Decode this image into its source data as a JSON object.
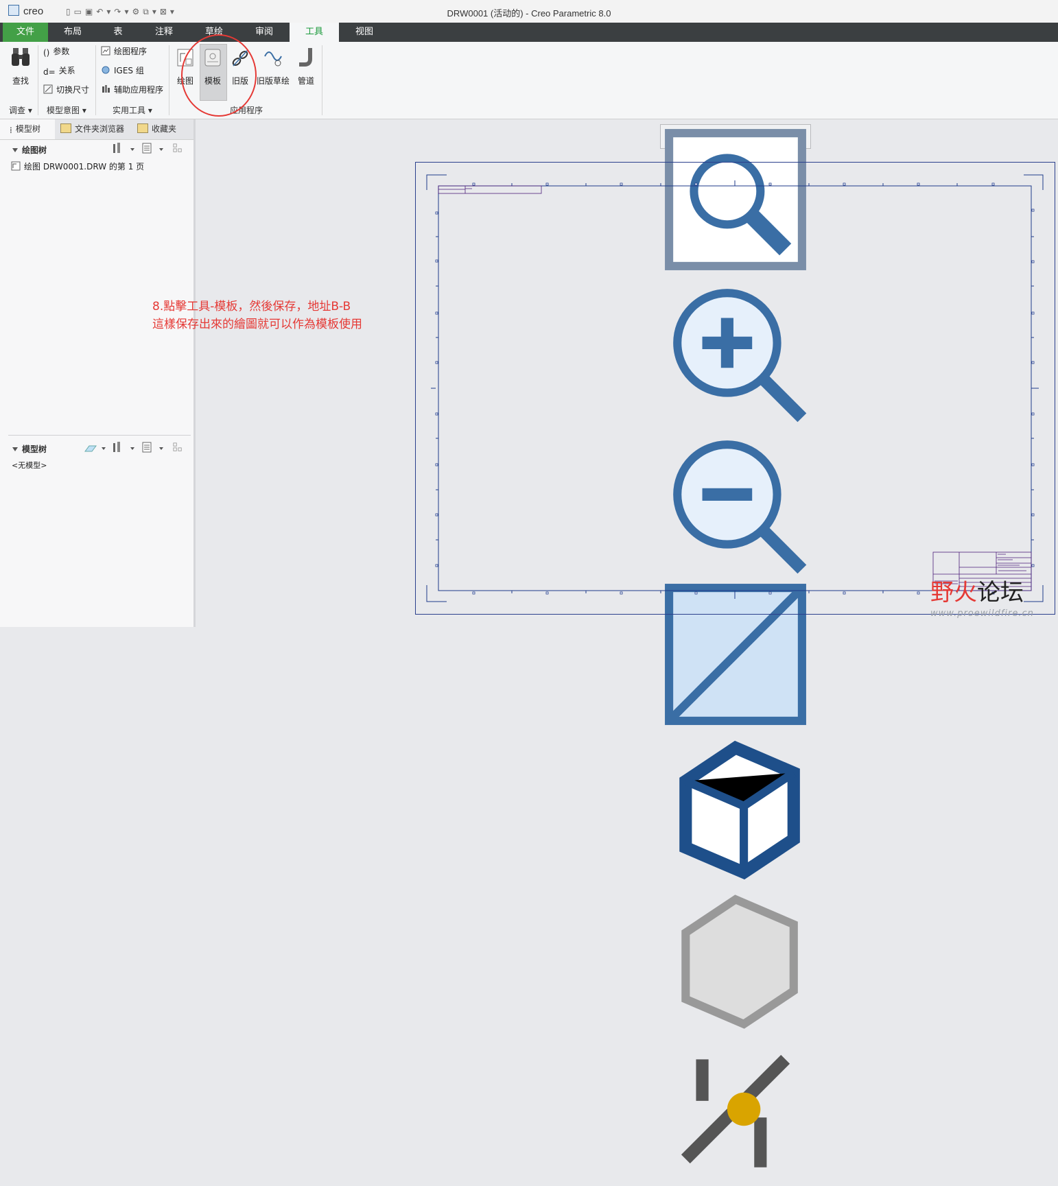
{
  "app": {
    "logo_text": "creo",
    "window_title": "DRW0001 (活动的) - Creo Parametric 8.0"
  },
  "tabs": [
    "文件",
    "布局",
    "表",
    "注释",
    "草绘",
    "审阅",
    "工具",
    "视图"
  ],
  "ribbon": {
    "investigate": {
      "find_label": "查找",
      "group_label": "调查"
    },
    "model_intent": {
      "params": "参数",
      "relations": "关系",
      "switch_dims": "切换尺寸",
      "group_label": "模型意图"
    },
    "utilities": {
      "drawing_program": "绘图程序",
      "iges_group": "IGES 组",
      "aux_apps": "辅助应用程序",
      "group_label": "实用工具"
    },
    "applications": {
      "drawing": "绘图",
      "template": "模板",
      "legacy": "旧版",
      "legacy_sketch": "旧版草绘",
      "piping": "管道",
      "group_label": "应用程序"
    }
  },
  "left_panel": {
    "tabs": [
      "模型树",
      "文件夹浏览器",
      "收藏夹"
    ],
    "drawing_tree": {
      "title": "绘图树",
      "item": "绘图 DRW0001.DRW 的第 1 页"
    },
    "model_tree": {
      "title": "模型树",
      "empty": "<无模型>"
    }
  },
  "annotation": {
    "line1": "8.點擊工具-模板，然後保存，地址B-B",
    "line2": "這樣保存出來的繪圖就可以作為模板使用"
  },
  "watermark": {
    "part1": "野火",
    "part2": "论坛",
    "url": "www.proewildfire.cn"
  },
  "colors": {
    "accent_green": "#1a9a3b",
    "file_tab": "#43a047",
    "annotation_red": "#e53935",
    "sheet_border": "#2a3f8c"
  }
}
